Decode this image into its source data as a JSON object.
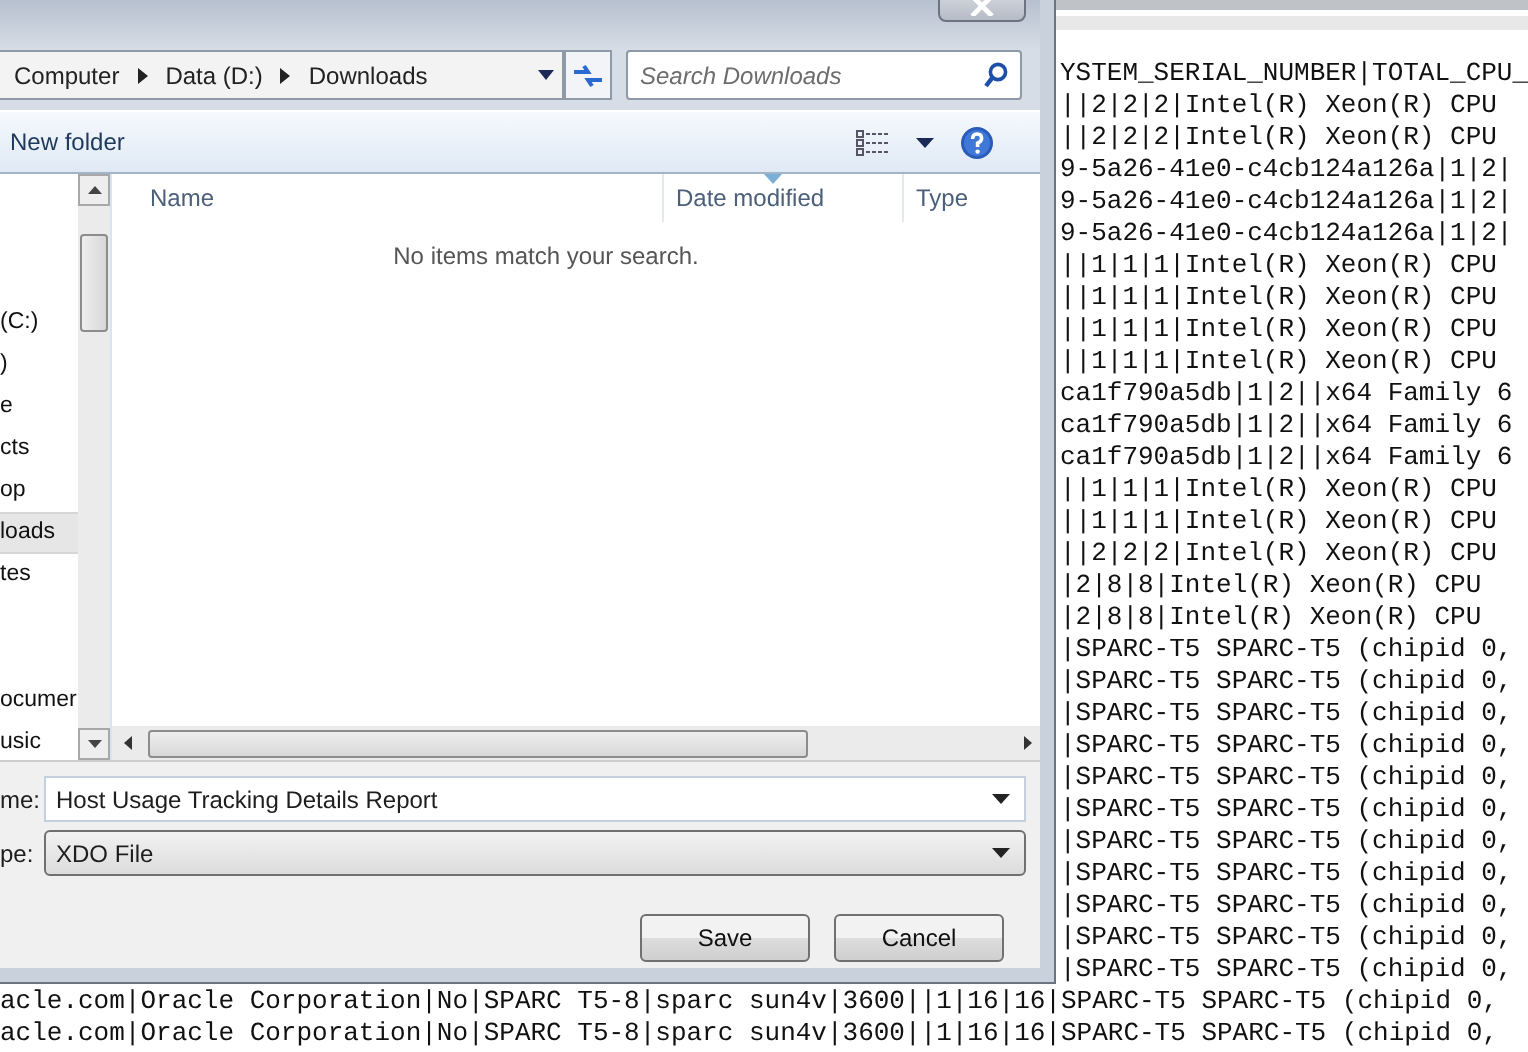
{
  "editor": {
    "lines": [
      "YSTEM_SERIAL_NUMBER|TOTAL_CPU_",
      "||2|2|2|Intel(R) Xeon(R) CPU",
      "||2|2|2|Intel(R) Xeon(R) CPU",
      "9-5a26-41e0-c4cb124a126a|1|2|",
      "9-5a26-41e0-c4cb124a126a|1|2|",
      "9-5a26-41e0-c4cb124a126a|1|2|",
      "||1|1|1|Intel(R) Xeon(R) CPU",
      "||1|1|1|Intel(R) Xeon(R) CPU",
      "||1|1|1|Intel(R) Xeon(R) CPU",
      "||1|1|1|Intel(R) Xeon(R) CPU",
      "ca1f790a5db|1|2||x64 Family 6",
      "ca1f790a5db|1|2||x64 Family 6",
      "ca1f790a5db|1|2||x64 Family 6",
      "||1|1|1|Intel(R) Xeon(R) CPU",
      "||1|1|1|Intel(R) Xeon(R) CPU",
      "||2|2|2|Intel(R) Xeon(R) CPU",
      "|2|8|8|Intel(R) Xeon(R) CPU",
      "|2|8|8|Intel(R) Xeon(R) CPU",
      "|SPARC-T5 SPARC-T5 (chipid 0,",
      "|SPARC-T5 SPARC-T5 (chipid 0,",
      "|SPARC-T5 SPARC-T5 (chipid 0,",
      "|SPARC-T5 SPARC-T5 (chipid 0,",
      "|SPARC-T5 SPARC-T5 (chipid 0,",
      "|SPARC-T5 SPARC-T5 (chipid 0,",
      "|SPARC-T5 SPARC-T5 (chipid 0,",
      "|SPARC-T5 SPARC-T5 (chipid 0,",
      "|SPARC-T5 SPARC-T5 (chipid 0,",
      "|SPARC-T5 SPARC-T5 (chipid 0,",
      "|SPARC-T5 SPARC-T5 (chipid 0,"
    ],
    "bottom_lines": [
      "acle.com|Oracle Corporation|No|SPARC T5-8|sparc sun4v|3600||1|16|16|SPARC-T5 SPARC-T5 (chipid 0,",
      "acle.com|Oracle Corporation|No|SPARC T5-8|sparc sun4v|3600||1|16|16|SPARC-T5 SPARC-T5 (chipid 0,"
    ]
  },
  "dialog": {
    "breadcrumb": [
      "Computer",
      "Data (D:)",
      "Downloads"
    ],
    "search": {
      "placeholder": "Search Downloads"
    },
    "toolbar": {
      "new_folder": "New folder"
    },
    "nav": {
      "groups": [
        {
          "items": [
            {
              "label": "(C:)",
              "selected": false
            },
            {
              "label": ")",
              "selected": false
            },
            {
              "label": "e",
              "selected": false
            },
            {
              "label": "cts",
              "selected": false
            },
            {
              "label": "op",
              "selected": false
            },
            {
              "label": "loads",
              "selected": true
            },
            {
              "label": "tes",
              "selected": false
            }
          ]
        },
        {
          "items": [
            {
              "label": "ocumer",
              "selected": false
            },
            {
              "label": "usic",
              "selected": false
            }
          ]
        }
      ]
    },
    "columns": [
      {
        "label": "Name",
        "sorted": false
      },
      {
        "label": "Date modified",
        "sorted": true
      },
      {
        "label": "Type",
        "sorted": false
      }
    ],
    "empty_message": "No items match your search.",
    "fields": [
      {
        "label": "me:",
        "kind": "combo",
        "value": "Host Usage Tracking Details Report"
      },
      {
        "label": "pe:",
        "kind": "select",
        "value": "XDO File"
      }
    ],
    "buttons": [
      {
        "label": "Save"
      },
      {
        "label": "Cancel"
      }
    ]
  }
}
